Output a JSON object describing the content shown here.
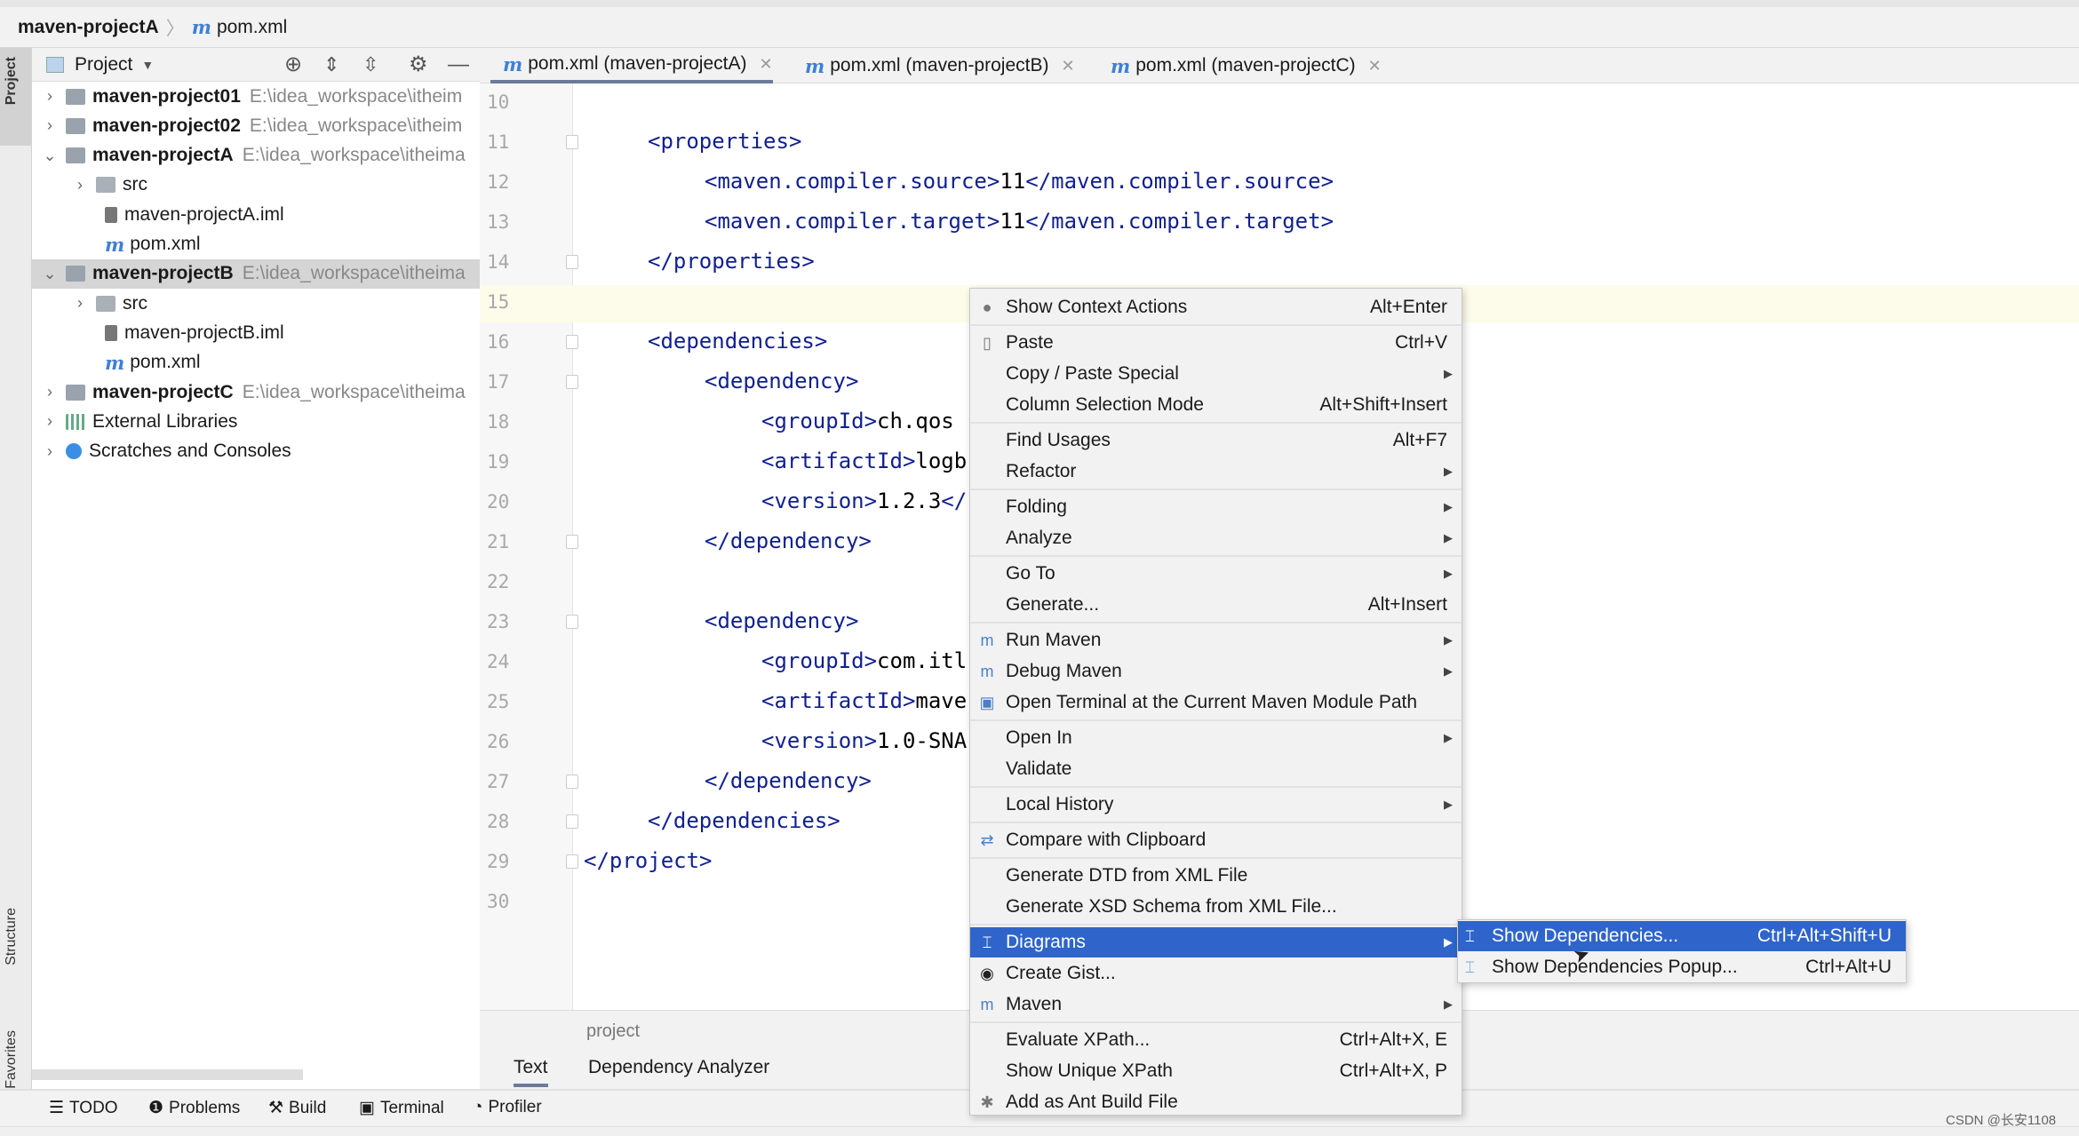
{
  "breadcrumb": {
    "project": "maven-projectA",
    "file": "pom.xml"
  },
  "left_strip": {
    "project": "Project",
    "structure": "Structure",
    "favorites": "Favorites"
  },
  "project_panel": {
    "title": "Project",
    "tree": [
      {
        "level": 0,
        "expanded": false,
        "label": "maven-project01",
        "path": "E:\\idea_workspace\\itheim",
        "bold": true,
        "icon": "module-folder-icon"
      },
      {
        "level": 0,
        "expanded": false,
        "label": "maven-project02",
        "path": "E:\\idea_workspace\\itheim",
        "bold": true,
        "icon": "module-folder-icon"
      },
      {
        "level": 0,
        "expanded": true,
        "label": "maven-projectA",
        "path": "E:\\idea_workspace\\itheima",
        "bold": true,
        "icon": "module-folder-icon"
      },
      {
        "level": 1,
        "expanded": false,
        "label": "src",
        "icon": "folder-icon"
      },
      {
        "level": 1,
        "label": "maven-projectA.iml",
        "icon": "iml-file-icon"
      },
      {
        "level": 1,
        "label": "pom.xml",
        "icon": "maven-icon"
      },
      {
        "level": 0,
        "expanded": true,
        "label": "maven-projectB",
        "path": "E:\\idea_workspace\\itheima",
        "bold": true,
        "selected": true,
        "icon": "module-folder-icon"
      },
      {
        "level": 1,
        "expanded": false,
        "label": "src",
        "icon": "folder-icon"
      },
      {
        "level": 1,
        "label": "maven-projectB.iml",
        "icon": "iml-file-icon"
      },
      {
        "level": 1,
        "label": "pom.xml",
        "icon": "maven-icon"
      },
      {
        "level": 0,
        "expanded": false,
        "label": "maven-projectC",
        "path": "E:\\idea_workspace\\itheima",
        "bold": true,
        "icon": "module-folder-icon"
      },
      {
        "level": 0,
        "expanded": false,
        "label": "External Libraries",
        "icon": "libraries-icon"
      },
      {
        "level": 0,
        "expanded": false,
        "label": "Scratches and Consoles",
        "icon": "scratches-icon"
      }
    ]
  },
  "tabs": [
    {
      "label": "pom.xml (maven-projectA)",
      "active": true
    },
    {
      "label": "pom.xml (maven-projectB)"
    },
    {
      "label": "pom.xml (maven-projectC)"
    }
  ],
  "code": [
    {
      "n": "10",
      "indent": 0,
      "text": ""
    },
    {
      "n": "11",
      "indent": 1,
      "text": "<properties>"
    },
    {
      "n": "12",
      "indent": 2,
      "text": "<maven.compiler.source>11</maven.compiler.source>"
    },
    {
      "n": "13",
      "indent": 2,
      "text": "<maven.compiler.target>11</maven.compiler.target>"
    },
    {
      "n": "14",
      "indent": 1,
      "text": "</properties>"
    },
    {
      "n": "15",
      "indent": 0,
      "text": ""
    },
    {
      "n": "16",
      "indent": 1,
      "text": "<dependencies>"
    },
    {
      "n": "17",
      "indent": 2,
      "text": "<dependency>"
    },
    {
      "n": "18",
      "indent": 3,
      "text": "<groupId>ch.qos"
    },
    {
      "n": "19",
      "indent": 3,
      "text": "<artifactId>logb"
    },
    {
      "n": "20",
      "indent": 3,
      "text": "<version>1.2.3</"
    },
    {
      "n": "21",
      "indent": 2,
      "text": "</dependency>"
    },
    {
      "n": "22",
      "indent": 0,
      "text": ""
    },
    {
      "n": "23",
      "indent": 2,
      "text": "<dependency>"
    },
    {
      "n": "24",
      "indent": 3,
      "text": "<groupId>com.itl"
    },
    {
      "n": "25",
      "indent": 3,
      "text": "<artifactId>mave"
    },
    {
      "n": "26",
      "indent": 3,
      "text": "<version>1.0-SNA"
    },
    {
      "n": "27",
      "indent": 2,
      "text": "</dependency>"
    },
    {
      "n": "28",
      "indent": 1,
      "text": "</dependencies>"
    },
    {
      "n": "29",
      "indent": 0,
      "text": "</project>"
    },
    {
      "n": "30",
      "indent": 0,
      "text": ""
    }
  ],
  "bottom_panel": {
    "breadcrumb": "project",
    "tabs": [
      "Text",
      "Dependency Analyzer"
    ],
    "active_tab": "Text"
  },
  "toolbar": [
    {
      "label": "TODO",
      "icon": "list-icon"
    },
    {
      "label": "Problems",
      "icon": "problems-icon"
    },
    {
      "label": "Build",
      "icon": "hammer-icon"
    },
    {
      "label": "Terminal",
      "icon": "terminal-icon"
    },
    {
      "label": "Profiler",
      "icon": "profiler-icon"
    }
  ],
  "context_menu": [
    {
      "label": "Show Context Actions",
      "shortcut": "Alt+Enter",
      "icon": "bulb-icon",
      "sep_after": true
    },
    {
      "label": "Paste",
      "shortcut": "Ctrl+V",
      "icon": "clipboard-icon"
    },
    {
      "label": "Copy / Paste Special",
      "submenu": true
    },
    {
      "label": "Column Selection Mode",
      "shortcut": "Alt+Shift+Insert",
      "sep_after": true
    },
    {
      "label": "Find Usages",
      "shortcut": "Alt+F7"
    },
    {
      "label": "Refactor",
      "submenu": true,
      "sep_after": true
    },
    {
      "label": "Folding",
      "submenu": true
    },
    {
      "label": "Analyze",
      "submenu": true,
      "sep_after": true
    },
    {
      "label": "Go To",
      "submenu": true
    },
    {
      "label": "Generate...",
      "shortcut": "Alt+Insert",
      "sep_after": true
    },
    {
      "label": "Run Maven",
      "submenu": true,
      "icon": "run-maven-icon"
    },
    {
      "label": "Debug Maven",
      "submenu": true,
      "icon": "debug-maven-icon"
    },
    {
      "label": "Open Terminal at the Current Maven Module Path",
      "icon": "terminal-maven-icon",
      "sep_after": true
    },
    {
      "label": "Open In",
      "submenu": true
    },
    {
      "label": "Validate",
      "sep_after": true
    },
    {
      "label": "Local History",
      "submenu": true,
      "sep_after": true
    },
    {
      "label": "Compare with Clipboard",
      "icon": "compare-icon",
      "sep_after": true
    },
    {
      "label": "Generate DTD from XML File"
    },
    {
      "label": "Generate XSD Schema from XML File...",
      "sep_after": true
    },
    {
      "label": "Diagrams",
      "submenu": true,
      "highlighted": true,
      "icon": "diagram-icon"
    },
    {
      "label": "Create Gist...",
      "icon": "github-icon"
    },
    {
      "label": "Maven",
      "submenu": true,
      "icon": "maven-icon",
      "sep_after": true
    },
    {
      "label": "Evaluate XPath...",
      "shortcut": "Ctrl+Alt+X, E"
    },
    {
      "label": "Show Unique XPath",
      "shortcut": "Ctrl+Alt+X, P"
    },
    {
      "label": "Add as Ant Build File",
      "icon": "ant-icon"
    }
  ],
  "submenu": [
    {
      "label": "Show Dependencies...",
      "shortcut": "Ctrl+Alt+Shift+U",
      "highlighted": true
    },
    {
      "label": "Show Dependencies Popup...",
      "shortcut": "Ctrl+Alt+U"
    }
  ],
  "watermark": "CSDN @长安1108",
  "colors": {
    "selection": "#2f65ca",
    "xml_tag": "#101f8f",
    "current_line": "#fdfbea"
  }
}
